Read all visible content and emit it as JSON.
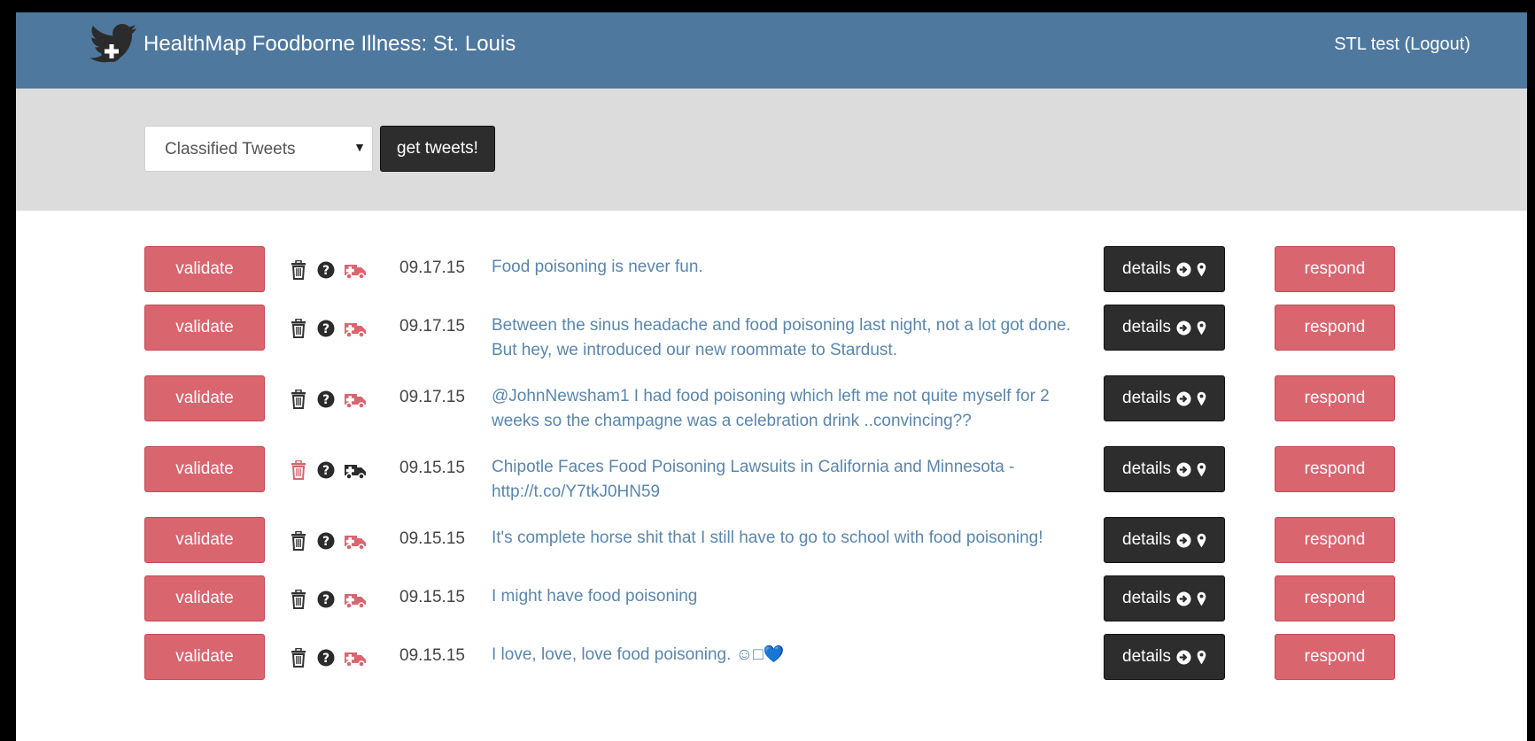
{
  "app": {
    "title": "HealthMap Foodborne Illness: St. Louis",
    "user_link": "STL test (Logout)",
    "colors": {
      "header": "#4e789e",
      "accent_red": "#d9656f",
      "dark": "#2d2d2d",
      "link": "#5a86ad"
    }
  },
  "filter": {
    "selected": "Classified Tweets",
    "button_label": "get tweets!"
  },
  "labels": {
    "validate": "validate",
    "details": "details",
    "respond": "respond"
  },
  "icons": [
    "trash-icon",
    "help-icon",
    "ambulance-icon",
    "arrow-circle-right-icon",
    "map-marker-icon"
  ],
  "tweets": [
    {
      "date": "09.17.15",
      "text": "Food poisoning is never fun.",
      "trash_active": false,
      "ambulance_active": true
    },
    {
      "date": "09.17.15",
      "text": "Between the sinus headache and food poisoning last night, not a lot got done. But hey, we introduced our new roommate to Stardust.",
      "trash_active": false,
      "ambulance_active": true
    },
    {
      "date": "09.17.15",
      "text": "@JohnNewsham1 I had food poisoning which left me not quite myself for 2 weeks so the champagne was a celebration drink ..convincing??",
      "trash_active": false,
      "ambulance_active": true
    },
    {
      "date": "09.15.15",
      "text": "Chipotle Faces Food Poisoning Lawsuits in California and Minnesota - http://t.co/Y7tkJ0HN59",
      "trash_active": true,
      "ambulance_active": false
    },
    {
      "date": "09.15.15",
      "text": "It's complete horse shit that I still have to go to school with food poisoning!",
      "trash_active": false,
      "ambulance_active": true
    },
    {
      "date": "09.15.15",
      "text": "I might have food poisoning",
      "trash_active": false,
      "ambulance_active": true
    },
    {
      "date": "09.15.15",
      "text": "I love, love, love food poisoning. ☺︎□💙",
      "trash_active": false,
      "ambulance_active": true
    }
  ]
}
